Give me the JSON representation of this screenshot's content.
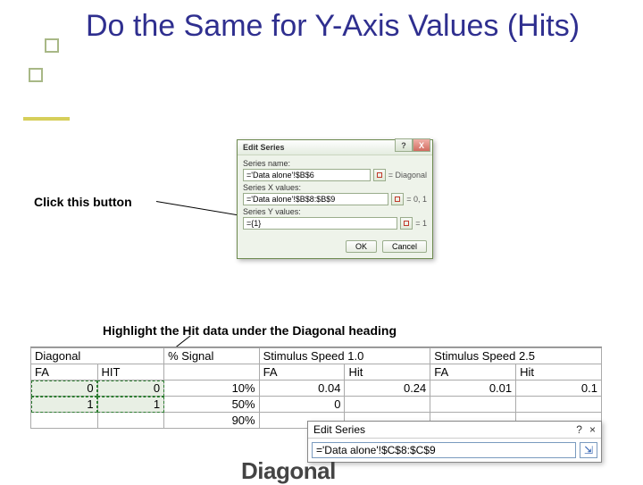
{
  "slide": {
    "title": "Do the Same for Y-Axis Values (Hits)",
    "instruction1": "Click this button",
    "instruction2": "Highlight the Hit data under the Diagonal heading"
  },
  "dialog": {
    "title": "Edit Series",
    "label_name": "Series name:",
    "val_name": "='Data alone'!$B$6",
    "eq_name": "= Diagonal",
    "label_x": "Series X values:",
    "val_x": "='Data alone'!$B$8:$B$9",
    "eq_x": "= 0, 1",
    "label_y": "Series Y values:",
    "val_y": "={1}",
    "eq_y": "= 1",
    "ok": "OK",
    "cancel": "Cancel",
    "help_glyph": "?",
    "close_glyph": "X"
  },
  "sheet": {
    "groups": [
      "Diagonal",
      "% Signal",
      "Stimulus Speed 1.0",
      "Stimulus Speed 2.5"
    ],
    "cols": {
      "diag": [
        "FA",
        "HIT"
      ],
      "sig": [
        ""
      ],
      "s10": [
        "FA",
        "Hit"
      ],
      "s25": [
        "FA",
        "Hit"
      ]
    },
    "rows": [
      {
        "diag_fa": "0",
        "diag_hit": "0",
        "sig": "10%",
        "s10_fa": "0.04",
        "s10_hit": "0.24",
        "s25_fa": "0.01",
        "s25_hit": "0.1"
      },
      {
        "diag_fa": "1",
        "diag_hit": "1",
        "sig": "50%",
        "s10_fa": "0",
        "s10_hit": "",
        "s25_fa": "",
        "s25_hit": ""
      },
      {
        "diag_fa": "",
        "diag_hit": "",
        "sig": "90%",
        "s10_fa": "",
        "s10_hit": "",
        "s25_fa": "",
        "s25_hit": ""
      }
    ]
  },
  "mini": {
    "title": "Edit Series",
    "val": "='Data alone'!$C$8:$C$9",
    "help": "?",
    "close": "×",
    "expand": "⇲"
  },
  "cutoff_text": "Diagonal"
}
